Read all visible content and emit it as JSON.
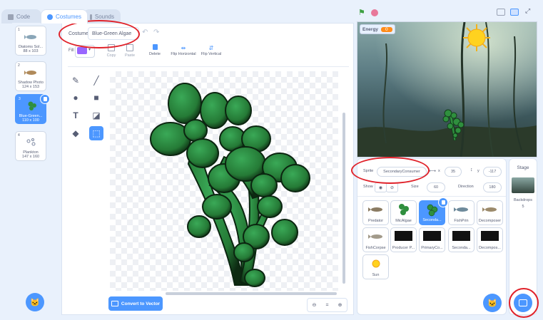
{
  "tabs": {
    "code": "Code",
    "costumes": "Costumes",
    "sounds": "Sounds"
  },
  "costumes": [
    {
      "num": "1",
      "name": "Diatoms Sol...",
      "size": "88 x 103"
    },
    {
      "num": "2",
      "name": "Shadow Photo",
      "size": "124 x 153"
    },
    {
      "num": "3",
      "name": "Blue-Green...",
      "size": "110 x 100"
    },
    {
      "num": "4",
      "name": "Plankton",
      "size": "147 x 160"
    }
  ],
  "editor": {
    "costume_label": "Costume",
    "costume_name": "Blue-Green Algae",
    "fill_label": "Fill",
    "actions": [
      "Copy",
      "Paste",
      "Delete",
      "Flip Horizontal",
      "Flip Vertical"
    ],
    "convert": "Convert to Vector",
    "zoom_reset": "="
  },
  "stage": {
    "monitor_label": "Energy",
    "monitor_value": "0"
  },
  "sprite_info": {
    "sprite_label": "Sprite",
    "sprite_name": "SecondaryConsumer",
    "x_label": "x",
    "x_value": "35",
    "y_label": "y",
    "y_value": "-117",
    "show_label": "Show",
    "size_label": "Size",
    "size_value": "60",
    "direction_label": "Direction",
    "direction_value": "180"
  },
  "sprites": [
    "Predator",
    "MicAlgae",
    "Seconda...",
    "FishPrin",
    "Decomposer",
    "FishCorpse",
    "Producer P...",
    "PrimaryCo...",
    "Seconda...",
    "Decompos...",
    "Sun"
  ],
  "stage_panel": {
    "title": "Stage",
    "backdrops_label": "Backdrops",
    "backdrops_count": "5"
  },
  "colors": {
    "accent": "#4c97ff",
    "fill": "#9966ff",
    "highlight": "#e0222a",
    "green": "#2f8f3e"
  }
}
